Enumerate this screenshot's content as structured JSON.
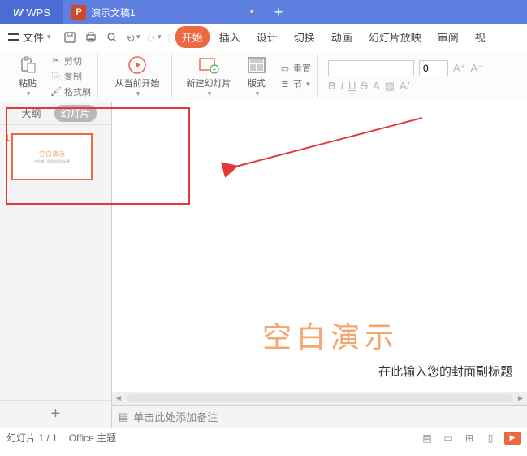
{
  "titlebar": {
    "wps": "WPS",
    "doc": "演示文稿1",
    "modified": "•",
    "plus": "+"
  },
  "file_menu": "文件",
  "tabs": {
    "start": "开始",
    "insert": "插入",
    "design": "设计",
    "transition": "切换",
    "animation": "动画",
    "slideshow": "幻灯片放映",
    "review": "审阅",
    "view": "视"
  },
  "ribbon": {
    "paste": "粘贴",
    "cut": "剪切",
    "copy": "复制",
    "format_painter": "格式刷",
    "from_current": "从当前开始",
    "new_slide": "新建幻灯片",
    "layout": "版式",
    "section": "节",
    "reset": "重置",
    "font_size": "0",
    "font_name": "",
    "a_plus": "A⁺",
    "a_minus": "A⁻"
  },
  "leftpanel": {
    "outline": "大纲",
    "slides": "幻灯片",
    "thumb_num": "1",
    "thumb_title": "空白演示",
    "thumb_sub": "在此输入您的封面副标题"
  },
  "slide": {
    "title": "空白演示",
    "subtitle": "在此输入您的封面副标题"
  },
  "notes": "单击此处添加备注",
  "status": {
    "counter": "幻灯片 1 / 1",
    "theme": "Office 主题"
  }
}
